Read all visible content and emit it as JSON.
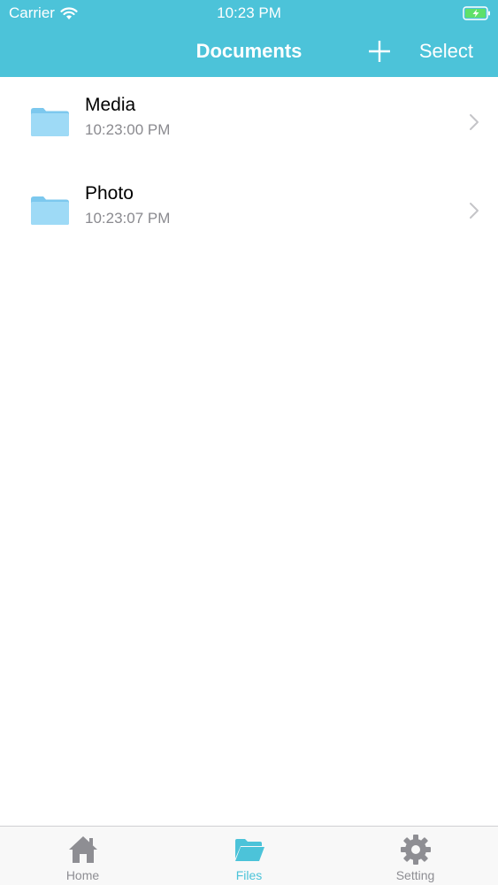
{
  "status_bar": {
    "carrier": "Carrier",
    "time": "10:23 PM"
  },
  "nav": {
    "title": "Documents",
    "select_label": "Select"
  },
  "files": [
    {
      "name": "Media",
      "time": "10:23:00 PM"
    },
    {
      "name": "Photo",
      "time": "10:23:07 PM"
    }
  ],
  "tabs": [
    {
      "label": "Home",
      "icon": "home-icon",
      "active": false
    },
    {
      "label": "Files",
      "icon": "folder-open-icon",
      "active": true
    },
    {
      "label": "Setting",
      "icon": "gear-icon",
      "active": false
    }
  ],
  "colors": {
    "accent": "#4cc3d9",
    "folder": "#8fd3f5",
    "inactive_tab": "#8e8e93"
  }
}
